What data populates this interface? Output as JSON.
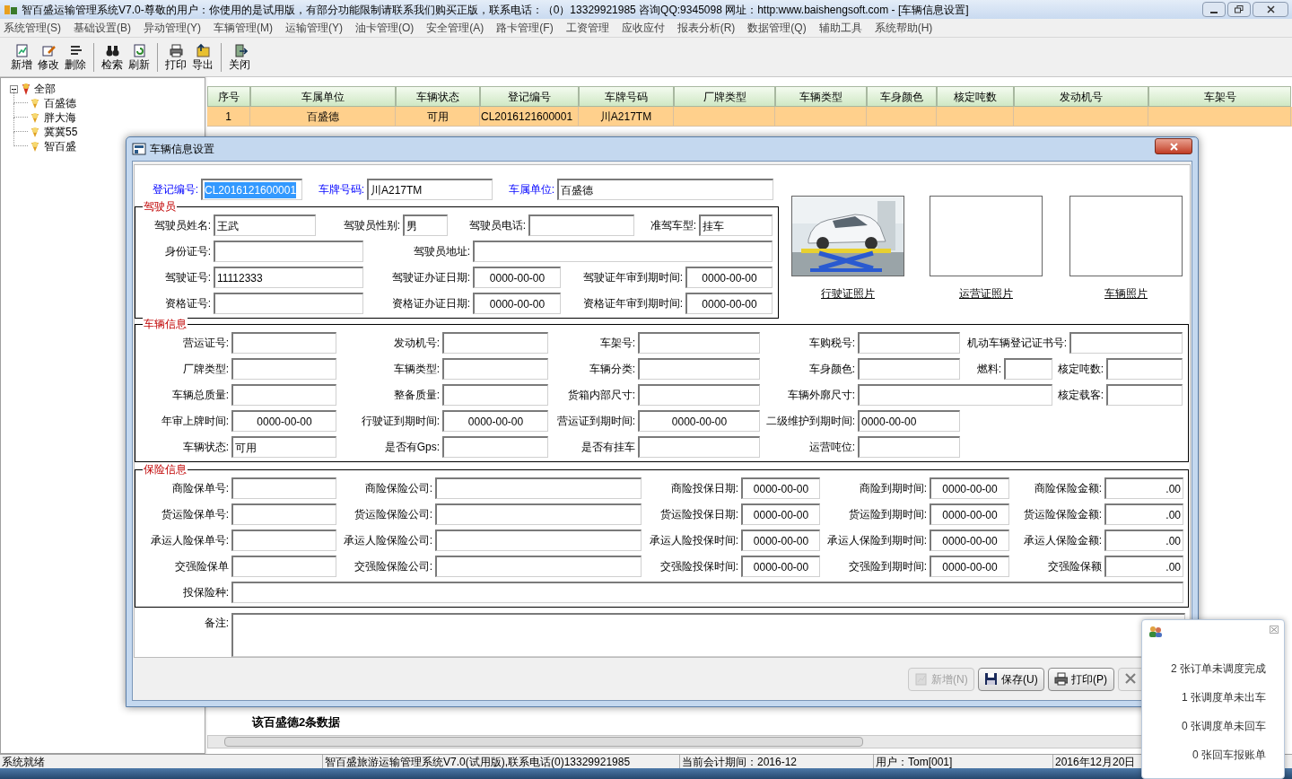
{
  "window": {
    "title": "智百盛运输管理系统V7.0-尊敬的用户：你使用的是试用版，有部分功能限制请联系我们购买正版，联系电话：（0）13329921985 咨询QQ:9345098 网址：http:www.baishengsoft.com - [车辆信息设置]"
  },
  "menu": [
    "系统管理(S)",
    "基础设置(B)",
    "异动管理(Y)",
    "车辆管理(M)",
    "运输管理(Y)",
    "油卡管理(O)",
    "安全管理(A)",
    "路卡管理(F)",
    "工资管理",
    "应收应付",
    "报表分析(R)",
    "数据管理(Q)",
    "辅助工具",
    "系统帮助(H)"
  ],
  "toolbar": [
    {
      "kind": "button",
      "label": "新增"
    },
    {
      "kind": "button",
      "label": "修改"
    },
    {
      "kind": "button",
      "label": "删除"
    },
    {
      "kind": "separator"
    },
    {
      "kind": "button",
      "label": "检索"
    },
    {
      "kind": "button",
      "label": "刷新"
    },
    {
      "kind": "separator"
    },
    {
      "kind": "button",
      "label": "打印"
    },
    {
      "kind": "button",
      "label": "导出"
    },
    {
      "kind": "separator"
    },
    {
      "kind": "button",
      "label": "关闭"
    }
  ],
  "tree": {
    "label": "全部",
    "expanded": true,
    "children": [
      {
        "label": "百盛德"
      },
      {
        "label": "胖大海"
      },
      {
        "label": "冀冀55"
      },
      {
        "label": "智百盛"
      }
    ]
  },
  "table": {
    "columns": [
      "序号",
      "车属单位",
      "车辆状态",
      "登记编号",
      "车牌号码",
      "厂牌类型",
      "车辆类型",
      "车身颜色",
      "核定吨数",
      "发动机号",
      "车架号"
    ],
    "rows": [
      {
        "selected": true,
        "cells": [
          "1",
          "百盛德",
          "可用",
          "CL2016121600001",
          "川A217TM"
        ]
      }
    ]
  },
  "record_count": "该百盛德2条数据",
  "dialog": {
    "title": "车辆信息设置",
    "top_row": [
      {
        "label": "登记编号:",
        "value": "CL2016121600001",
        "kind": "text",
        "highlighted": true
      },
      {
        "label": "车牌号码:",
        "value": "川A217TM",
        "kind": "text",
        "highlighted": false
      },
      {
        "label": "车属单位:",
        "value": "百盛德",
        "kind": "text",
        "highlighted": false
      }
    ],
    "driver": {
      "legend": "驾驶员",
      "fields": [
        {
          "label": "驾驶员姓名:",
          "value": "王武",
          "kind": "text"
        },
        {
          "label": "驾驶员性别:",
          "value": "男",
          "kind": "text"
        },
        {
          "label": "驾驶员电话:",
          "kind": "text"
        },
        {
          "label": "准驾车型:",
          "value": "挂车",
          "kind": "text"
        },
        {
          "label": "身份证号:",
          "kind": "text"
        },
        {
          "label": "驾驶员地址:",
          "kind": "text"
        },
        {
          "label": "驾驶证号:",
          "value": "11112333",
          "kind": "text"
        },
        {
          "label": "驾驶证办证日期:",
          "value": "0000-00-00",
          "kind": "date"
        },
        {
          "label": "驾驶证年审到期时间:",
          "value": "0000-00-00",
          "kind": "date"
        },
        {
          "label": "资格证号:",
          "kind": "text"
        },
        {
          "label": "资格证办证日期:",
          "value": "0000-00-00",
          "kind": "date"
        },
        {
          "label": "资格证年审到期时间:",
          "value": "0000-00-00",
          "kind": "date"
        }
      ]
    },
    "photos": [
      {
        "caption": "行驶证照片",
        "has_photo": true
      },
      {
        "caption": "运营证照片",
        "has_photo": false
      },
      {
        "caption": "车辆照片",
        "has_photo": false
      }
    ],
    "vehicle": {
      "legend": "车辆信息",
      "rows": [
        [
          {
            "label": "营运证号:",
            "kind": "text"
          },
          {
            "label": "发动机号:",
            "kind": "text"
          },
          {
            "label": "车架号:",
            "kind": "text"
          },
          {
            "label": "车购税号:",
            "kind": "text"
          },
          {
            "label": "机动车辆登记证书号:",
            "kind": "text"
          }
        ],
        [
          {
            "label": "厂牌类型:",
            "kind": "text"
          },
          {
            "label": "车辆类型:",
            "kind": "text"
          },
          {
            "label": "车辆分类:",
            "kind": "text"
          },
          {
            "label": "车身颜色:",
            "kind": "text"
          },
          {
            "label": "燃料:",
            "kind": "text"
          },
          {
            "label": "核定吨数:",
            "kind": "text"
          }
        ],
        [
          {
            "label": "车辆总质量:",
            "kind": "text"
          },
          {
            "label": "整备质量:",
            "kind": "text"
          },
          {
            "label": "货箱内部尺寸:",
            "kind": "text"
          },
          {
            "label": "车辆外廓尺寸:",
            "kind": "text"
          },
          {
            "label": "核定载客:",
            "kind": "text"
          }
        ],
        [
          {
            "label": "年审上牌时间:",
            "value": "0000-00-00",
            "kind": "date"
          },
          {
            "label": "行驶证到期时间:",
            "value": "0000-00-00",
            "kind": "date"
          },
          {
            "label": "营运证到期时间:",
            "value": "0000-00-00",
            "kind": "date"
          },
          {
            "label": "二级维护到期时间:",
            "value": "0000-00-00",
            "kind": "text"
          }
        ],
        [
          {
            "label": "车辆状态:",
            "value": "可用",
            "kind": "text"
          },
          {
            "label": "是否有Gps:",
            "kind": "text"
          },
          {
            "label": "是否有挂车",
            "kind": "text"
          },
          {
            "label": "运营吨位:",
            "kind": "text"
          }
        ]
      ]
    },
    "insurance": {
      "legend": "保险信息",
      "rows": [
        [
          {
            "label": "商险保单号:",
            "kind": "text"
          },
          {
            "label": "商险保险公司:",
            "kind": "text"
          },
          {
            "label": "商险投保日期:",
            "value": "0000-00-00",
            "kind": "date"
          },
          {
            "label": "商险到期时间:",
            "value": "0000-00-00",
            "kind": "date"
          },
          {
            "label": "商险保险金额:",
            "value": ".00",
            "kind": "amount"
          }
        ],
        [
          {
            "label": "货运险保单号:",
            "kind": "text"
          },
          {
            "label": "货运险保险公司:",
            "kind": "text"
          },
          {
            "label": "货运险投保日期:",
            "value": "0000-00-00",
            "kind": "date"
          },
          {
            "label": "货运险到期时间:",
            "value": "0000-00-00",
            "kind": "date"
          },
          {
            "label": "货运险保险金额:",
            "value": ".00",
            "kind": "amount"
          }
        ],
        [
          {
            "label": "承运人险保单号:",
            "kind": "text"
          },
          {
            "label": "承运人险保险公司:",
            "kind": "text"
          },
          {
            "label": "承运人险投保时间:",
            "value": "0000-00-00",
            "kind": "date"
          },
          {
            "label": "承运人保险到期时间:",
            "value": "0000-00-00",
            "kind": "date"
          },
          {
            "label": "承运人保险金额:",
            "value": ".00",
            "kind": "amount"
          }
        ],
        [
          {
            "label": "交强险保单",
            "kind": "text"
          },
          {
            "label": "交强险保险公司:",
            "kind": "text"
          },
          {
            "label": "交强险投保时间:",
            "value": "0000-00-00",
            "kind": "date"
          },
          {
            "label": "交强险到期时间:",
            "value": "0000-00-00",
            "kind": "date"
          },
          {
            "label": "交强险保额",
            "value": ".00",
            "kind": "amount"
          }
        ],
        [
          {
            "label": "投保险种:",
            "kind": "text"
          }
        ]
      ]
    },
    "remark": {
      "label": "备注:"
    },
    "buttons": [
      {
        "label": "新增(N)",
        "disabled": true
      },
      {
        "label": "保存(U)",
        "disabled": false
      },
      {
        "label": "打印(P)",
        "disabled": false
      },
      {
        "disabled": true
      }
    ]
  },
  "notifications": [
    "2 张订单未调度完成",
    "1 张调度单未出车",
    "0 张调度单未回车",
    "0 张回车报账单"
  ],
  "status_bar": [
    "系统就绪",
    "智百盛旅游运输管理系统V7.0(试用版),联系电话(0)13329921985",
    "当前会计期间：2016-12",
    "用户：Tom[001]",
    "2016年12月20日"
  ]
}
